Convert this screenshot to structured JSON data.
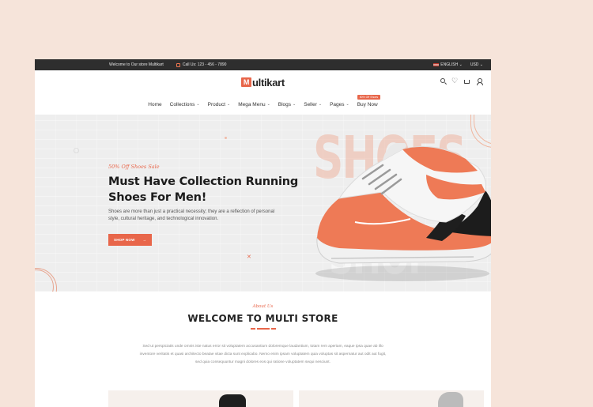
{
  "topbar": {
    "welcome": "Welcome to Our store Multikart",
    "phone": "Call Us: 123 - 456 - 7890",
    "language": "ENGLISH",
    "currency": "USD"
  },
  "logo": {
    "badge": "M",
    "text": "ultikart"
  },
  "nav": {
    "items": [
      {
        "label": "Home",
        "chevron": ""
      },
      {
        "label": "Collections",
        "chevron": "⌄"
      },
      {
        "label": "Product",
        "chevron": "⌄"
      },
      {
        "label": "Mega Menu",
        "chevron": "⌄"
      },
      {
        "label": "Blogs",
        "chevron": "⌄"
      },
      {
        "label": "Seller",
        "chevron": "⌄"
      },
      {
        "label": "Pages",
        "chevron": "⌄"
      },
      {
        "label": "Buy Now",
        "chevron": ""
      }
    ],
    "badge": "50% Off Shoes"
  },
  "hero": {
    "sale": "50% Off Shoes Sale",
    "title": "Must Have Collection Running Shoes For Men!",
    "description": "Shoes are more than just a practical necessity; they are a reflection of personal style, cultural heritage, and technological innovation.",
    "button": "SHOP NOW",
    "bg_word_top": "SHOES",
    "bg_word_bottom": "SHOP"
  },
  "about": {
    "subtitle": "About Us",
    "title": "WELCOME TO MULTI STORE",
    "text": "Sed ut perspiciatis unde omnis iste natus error sit voluptatem accusantium doloremque laudantium, totam rem aperiam, eaque ipsa quae ab illo inventore veritatis et quasi architecto beatae vitae dicta sunt explicabo. Nemo enim ipsam voluptatem quia voluptas sit aspernatur aut odit aut fugit, sed quia consequuntur magni dolores eos qui ratione voluptatem sequi nesciunt."
  },
  "colors": {
    "accent": "#e8664a",
    "topbar": "#2e2e2e",
    "page_bg": "#f6e4da"
  }
}
